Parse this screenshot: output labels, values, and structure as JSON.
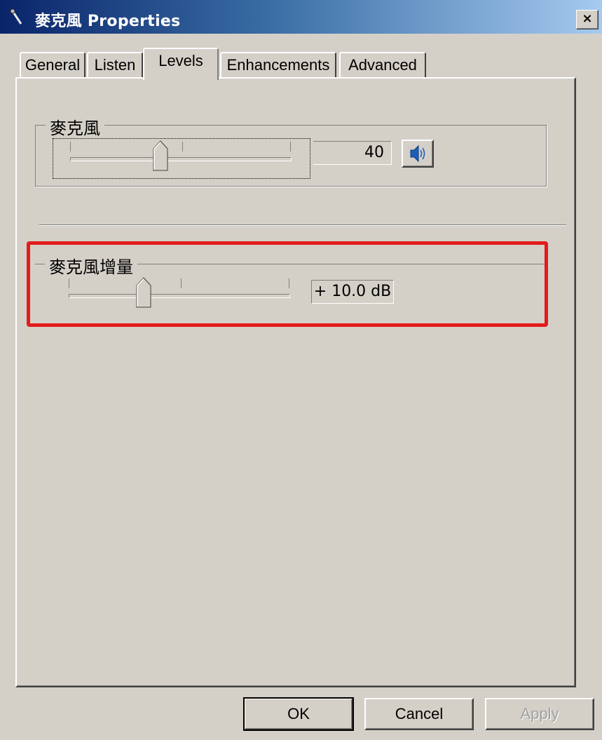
{
  "window": {
    "title": "麥克風 Properties",
    "close_label": "×",
    "icon": "microphone-icon"
  },
  "tabs": [
    {
      "label": "General",
      "active": false
    },
    {
      "label": "Listen",
      "active": false
    },
    {
      "label": "Levels",
      "active": true
    },
    {
      "label": "Enhancements",
      "active": false
    },
    {
      "label": "Advanced",
      "active": false
    }
  ],
  "levels": {
    "microphone": {
      "label": "麥克風",
      "value": "40",
      "slider_fraction": 0.4,
      "mute_icon": "speaker-icon"
    },
    "boost": {
      "label": "麥克風增量",
      "value": "+ 10.0 dB",
      "slider_fraction": 0.33
    }
  },
  "buttons": {
    "ok": "OK",
    "cancel": "Cancel",
    "apply": "Apply"
  },
  "colors": {
    "highlight": "#e41b1b",
    "titlebar_start": "#0a246a",
    "titlebar_end": "#a6caf0",
    "face": "#d4d0c8"
  }
}
